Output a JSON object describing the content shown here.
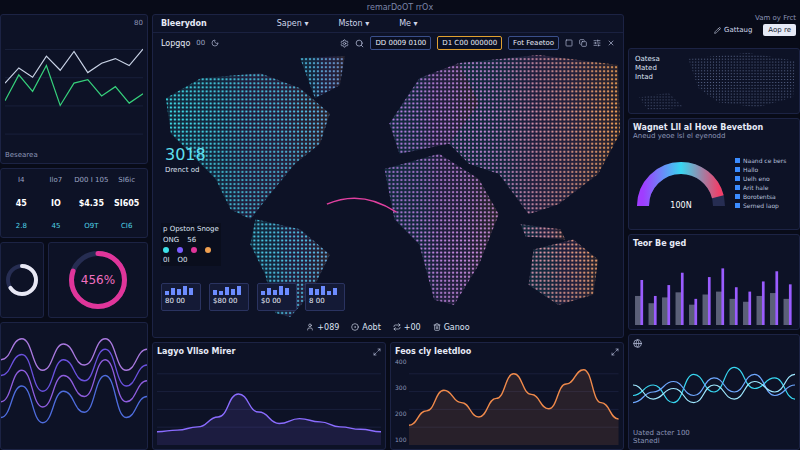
{
  "header": {
    "title": "remarDoOT rrOx"
  },
  "nav": {
    "brand": "Bleerydon",
    "menus": [
      {
        "label": "Sapen",
        "caret": "▾"
      },
      {
        "label": "Mston",
        "caret": "▾"
      },
      {
        "label": "Me",
        "caret": "▾"
      }
    ]
  },
  "toolbar": {
    "title": "Lopgqo",
    "badge": "00",
    "fields": [
      {
        "value": "DD 0009 0100",
        "selected": false
      },
      {
        "value": "D1 C00 000000",
        "selected": true
      },
      {
        "value": "Fot Feaetoo",
        "selected": false
      }
    ]
  },
  "left": {
    "line_chart": {
      "corner": "80",
      "caption": "Besearea",
      "min": 0,
      "max": 100,
      "series": [
        {
          "color": "#36d17c",
          "values": [
            40,
            62,
            48,
            70,
            36,
            55,
            58,
            44,
            52,
            38,
            46
          ]
        },
        {
          "color": "#c9d3e6",
          "values": [
            55,
            68,
            60,
            78,
            66,
            82,
            64,
            72,
            76,
            70,
            84
          ]
        }
      ]
    },
    "stats": [
      {
        "label": "I4",
        "value": "45",
        "foot": "2.8"
      },
      {
        "label": "Ilo7",
        "value": "IO",
        "foot": "45"
      },
      {
        "label": "D00 I 105",
        "value": "$4.35",
        "foot": "O9T"
      },
      {
        "label": "SI6ic",
        "value": "SI605",
        "foot": "CI6"
      }
    ],
    "ring_icon": {
      "level": 0.65
    },
    "ring": {
      "reading": "456%",
      "level": 0.8
    },
    "waves": {
      "min": -1,
      "max": 1,
      "series": [
        {
          "color": "#7b5cff",
          "values": [
            0.2,
            0.6,
            -0.1,
            0.5,
            0.1,
            0.7,
            0.0,
            0.4
          ]
        },
        {
          "color": "#a66bff",
          "values": [
            -0.3,
            0.3,
            -0.4,
            0.2,
            -0.2,
            0.5,
            -0.3,
            0.1
          ]
        },
        {
          "color": "#5a7dff",
          "values": [
            -0.6,
            0.0,
            -0.7,
            -0.1,
            -0.5,
            0.2,
            -0.6,
            -0.2
          ]
        },
        {
          "color": "#c58bff",
          "values": [
            0.5,
            0.9,
            0.3,
            0.8,
            0.4,
            0.9,
            0.3,
            0.7
          ]
        }
      ]
    }
  },
  "map": {
    "count": "3018",
    "count_label": "Drenct od",
    "options": {
      "title": "p Opston Snoge",
      "stats": [
        "ONG",
        "56"
      ],
      "codes": [
        "0I",
        "O0"
      ]
    },
    "cards": [
      {
        "value": "80 00",
        "bars": [
          3,
          5,
          4,
          6,
          5
        ]
      },
      {
        "value": "$80 00",
        "bars": [
          4,
          3,
          6,
          5,
          7
        ]
      },
      {
        "value": "$0 00",
        "bars": [
          2,
          4,
          3,
          5,
          4
        ]
      },
      {
        "value": "8 00",
        "bars": [
          5,
          4,
          6,
          3,
          5
        ]
      }
    ]
  },
  "bottom_strip": [
    "+089",
    "Aobt",
    "+00",
    "Ganoo"
  ],
  "charts": [
    {
      "title": "Lagyo Vllso Mirer",
      "color": "#8a6cff",
      "ticks": [],
      "min": 0,
      "max": 100,
      "values": [
        12,
        14,
        18,
        30,
        58,
        36,
        22,
        28,
        24,
        18,
        15,
        12
      ]
    },
    {
      "title": "Feos cly Ieetdloo",
      "color": "#f08a4b",
      "ticks": [
        "400",
        "300",
        "200",
        "100"
      ],
      "min": 0,
      "max": 400,
      "values": [
        80,
        150,
        250,
        190,
        120,
        210,
        330,
        230,
        160,
        280,
        350,
        190,
        110
      ]
    }
  ],
  "right": {
    "caption": "Vam oy Frct",
    "buttons": [
      {
        "label": "Gattaug",
        "selected": false
      },
      {
        "label": "Aop re",
        "selected": true
      }
    ],
    "map_labels": [
      "Oatesa",
      "Mated",
      "Intad"
    ],
    "gauge": {
      "title": "Wagnet Lll al Hove Bevetbon",
      "subtitle": "Aneud yeoe lsl el eyenodd",
      "reading": "100N",
      "level": 0.92,
      "legend": [
        "Naand ce bers",
        "Hallo",
        "Uelh eno",
        "Arit hale",
        "Borotentsa",
        "Serned laop"
      ]
    },
    "bars": {
      "title": "Teor Be ged",
      "max": 100,
      "series": [
        {
          "color": "#5b6078",
          "values": [
            40,
            30,
            38,
            45,
            28,
            42,
            46,
            36,
            32,
            40,
            44,
            36
          ]
        },
        {
          "color": "#9a5cff",
          "values": [
            62,
            40,
            55,
            72,
            36,
            66,
            78,
            52,
            46,
            60,
            74,
            56
          ]
        }
      ]
    },
    "waves": {
      "labels": [
        "Uated acter 100",
        "Stanedl"
      ],
      "min": 0,
      "max": 100,
      "series": [
        {
          "color": "#38d6f0",
          "values": [
            40,
            55,
            30,
            70,
            45,
            80,
            50,
            65,
            35
          ]
        },
        {
          "color": "#6fa8ff",
          "values": [
            30,
            45,
            60,
            40,
            65,
            45,
            70,
            40,
            55
          ]
        },
        {
          "color": "#9fe8ff",
          "values": [
            55,
            35,
            50,
            30,
            55,
            35,
            60,
            45,
            70
          ]
        }
      ]
    }
  }
}
